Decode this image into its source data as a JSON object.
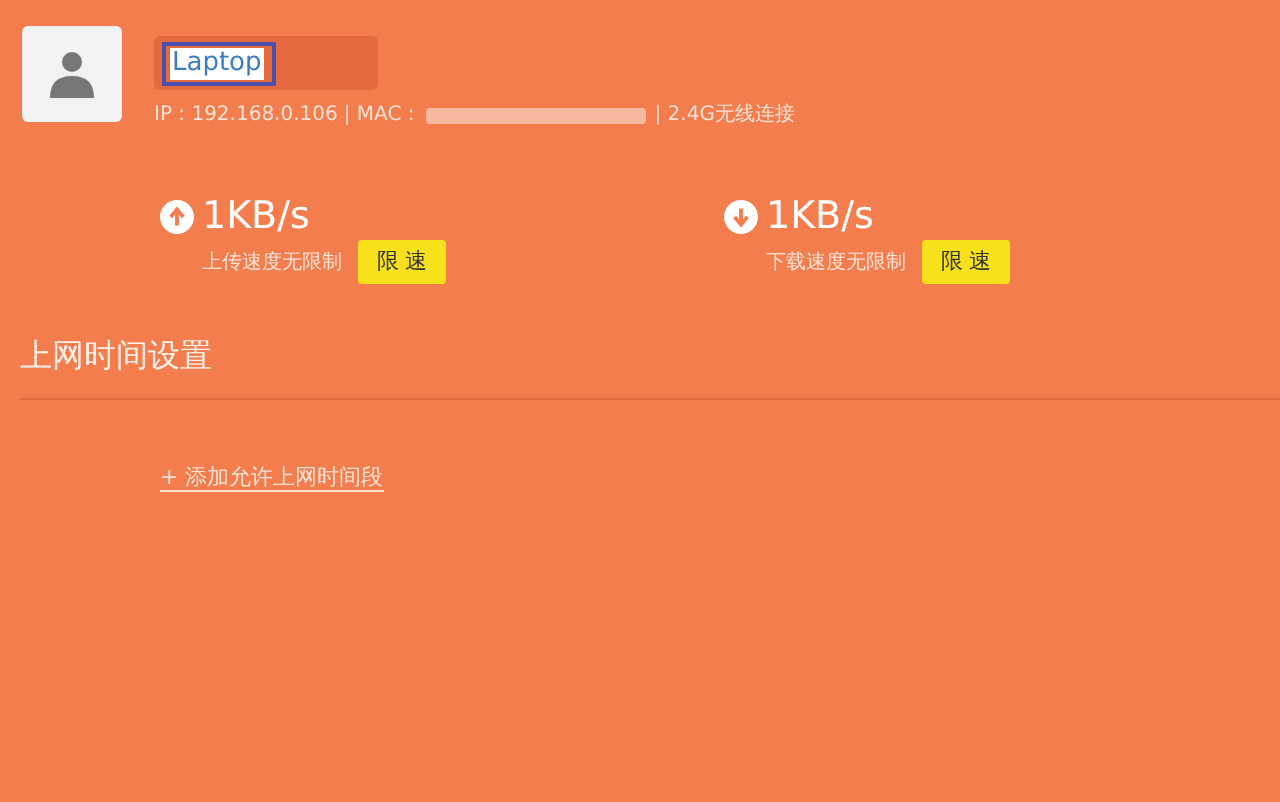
{
  "device": {
    "name": "Laptop",
    "ip_label": "IP : 192.168.0.106",
    "mac_label": "| MAC :",
    "connection": "| 2.4G无线连接"
  },
  "speeds": [
    {
      "kind": "upload",
      "rate": "1KB/s",
      "note": "上传速度无限制",
      "button": "限 速"
    },
    {
      "kind": "download",
      "rate": "1KB/s",
      "note": "下载速度无限制",
      "button": "限 速"
    }
  ],
  "section": {
    "title": "上网时间设置",
    "link": "+ 添加允许上网时间段"
  }
}
